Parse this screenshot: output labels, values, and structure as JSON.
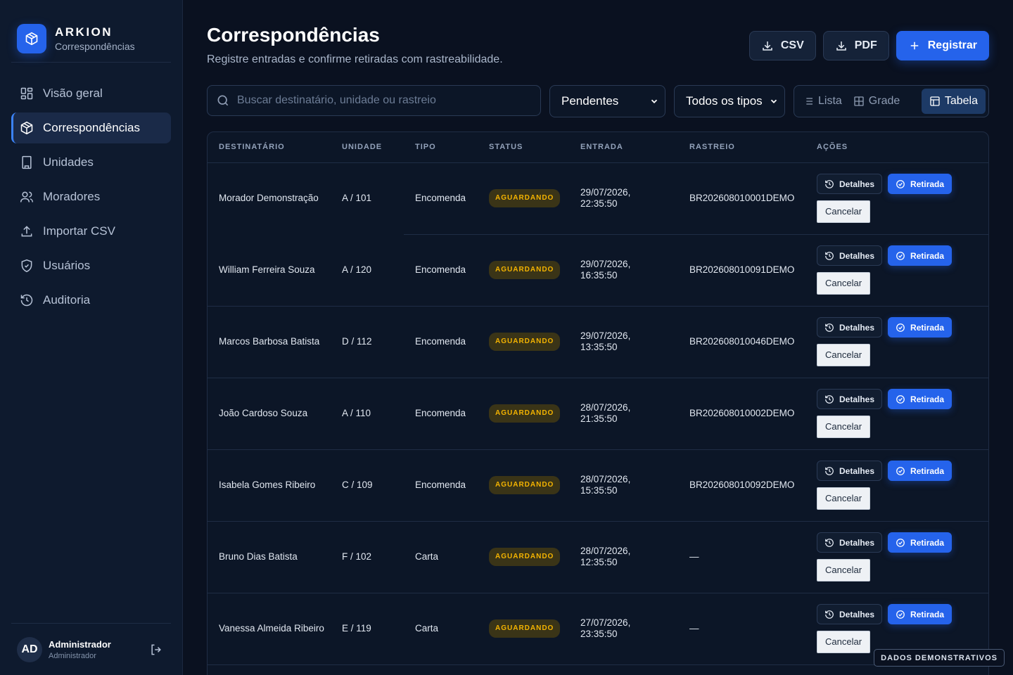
{
  "brand": {
    "name": "ARKION",
    "subtitle": "Correspondências",
    "icon": "package-icon"
  },
  "nav": [
    {
      "label": "Visão geral",
      "icon": "grid-icon",
      "active": false
    },
    {
      "label": "Correspondências",
      "icon": "package-icon",
      "active": true
    },
    {
      "label": "Unidades",
      "icon": "building-icon",
      "active": false
    },
    {
      "label": "Moradores",
      "icon": "users-icon",
      "active": false
    },
    {
      "label": "Importar CSV",
      "icon": "upload-icon",
      "active": false
    },
    {
      "label": "Usuários",
      "icon": "shield-icon",
      "active": false
    },
    {
      "label": "Auditoria",
      "icon": "history-icon",
      "active": false
    }
  ],
  "user": {
    "initials": "AD",
    "name": "Administrador",
    "role": "Administrador"
  },
  "header": {
    "title": "Correspondências",
    "subtitle": "Registre entradas e confirme retiradas com rastreabilidade.",
    "csv_label": "CSV",
    "pdf_label": "PDF",
    "register_label": "Registrar"
  },
  "filters": {
    "search_placeholder": "Buscar destinatário, unidade ou rastreio",
    "status_value": "Pendentes",
    "type_value": "Todos os tipos"
  },
  "views": {
    "list": "Lista",
    "grid": "Grade",
    "table": "Tabela",
    "active": "Tabela"
  },
  "table": {
    "columns": [
      "DESTINATÁRIO",
      "UNIDADE",
      "TIPO",
      "STATUS",
      "ENTRADA",
      "RASTREIO",
      "AÇÕES"
    ],
    "actions": {
      "details": "Detalhes",
      "pickup": "Retirada",
      "cancel": "Cancelar"
    },
    "rows": [
      {
        "recipient": "Morador Demonstração",
        "unit": "A / 101",
        "type": "Encomenda",
        "status": "AGUARDANDO",
        "entry_date": "29/07/2026,",
        "entry_time": "22:35:50",
        "tracking": "BR202608010001DEMO"
      },
      {
        "recipient": "William Ferreira Souza",
        "unit": "A / 120",
        "type": "Encomenda",
        "status": "AGUARDANDO",
        "entry_date": "29/07/2026,",
        "entry_time": "16:35:50",
        "tracking": "BR202608010091DEMO"
      },
      {
        "recipient": "Marcos Barbosa Batista",
        "unit": "D / 112",
        "type": "Encomenda",
        "status": "AGUARDANDO",
        "entry_date": "29/07/2026,",
        "entry_time": "13:35:50",
        "tracking": "BR202608010046DEMO"
      },
      {
        "recipient": "João Cardoso Souza",
        "unit": "A / 110",
        "type": "Encomenda",
        "status": "AGUARDANDO",
        "entry_date": "28/07/2026,",
        "entry_time": "21:35:50",
        "tracking": "BR202608010002DEMO"
      },
      {
        "recipient": "Isabela Gomes Ribeiro",
        "unit": "C / 109",
        "type": "Encomenda",
        "status": "AGUARDANDO",
        "entry_date": "28/07/2026,",
        "entry_time": "15:35:50",
        "tracking": "BR202608010092DEMO"
      },
      {
        "recipient": "Bruno Dias Batista",
        "unit": "F / 102",
        "type": "Carta",
        "status": "AGUARDANDO",
        "entry_date": "28/07/2026,",
        "entry_time": "12:35:50",
        "tracking": "—"
      },
      {
        "recipient": "Vanessa Almeida Ribeiro",
        "unit": "E / 119",
        "type": "Carta",
        "status": "AGUARDANDO",
        "entry_date": "27/07/2026,",
        "entry_time": "23:35:50",
        "tracking": "—"
      }
    ]
  },
  "demo_badge": "DADOS DEMONSTRATIVOS",
  "colors": {
    "accent": "#2563eb",
    "background": "#0a1120",
    "sidebar": "#0e1a2e",
    "status_pending": "#f5b400"
  }
}
